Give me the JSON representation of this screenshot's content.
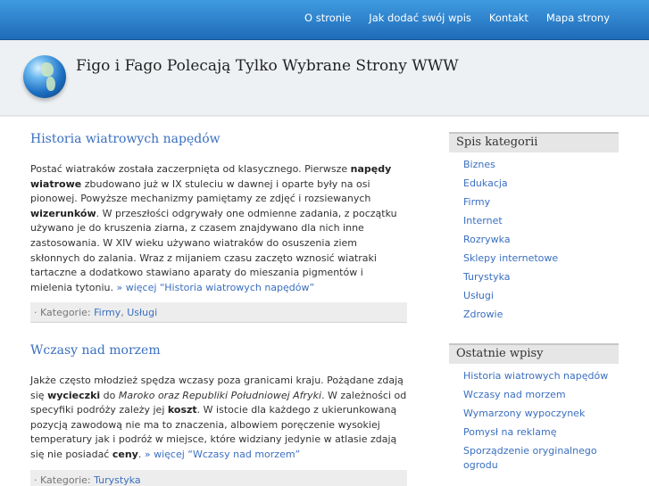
{
  "nav": {
    "items": [
      "O stronie",
      "Jak dodać swój wpis",
      "Kontakt",
      "Mapa strony"
    ]
  },
  "site": {
    "title": "Figo i Fago Polecają Tylko Wybrane Strony WWW"
  },
  "posts": [
    {
      "title": "Historia wiatrowych napędów",
      "body": [
        {
          "t": "Postać wiatraków została zaczerpnięta od klasycznego. Pierwsze "
        },
        {
          "b": "napędy wiatrowe"
        },
        {
          "t": " zbudowano już w IX stuleciu w dawnej i oparte były na osi pionowej. Powyższe mechanizmy pamiętamy ze zdjęć i rozsiewanych "
        },
        {
          "b": "wizerunków"
        },
        {
          "t": ". W przeszłości odgrywały one odmienne zadania, z początku używano je do kruszenia ziarna, z czasem znajdywano dla nich inne zastosowania. W XIV wieku używano wiatraków do osuszenia ziem skłonnych do zalania. Wraz z mijaniem czasu zaczęto wznosić wiatraki tartaczne a dodatkowo stawiano aparaty do mieszania pigmentów i mielenia tytoniu. "
        },
        {
          "a": "» więcej “Historia wiatrowych napędów”"
        }
      ],
      "categories_label": "· Kategorie:",
      "categories": [
        "Firmy",
        "Usługi"
      ]
    },
    {
      "title": "Wczasy nad morzem",
      "body": [
        {
          "t": "Jakże często młodzież spędza wczasy poza granicami kraju. Pożądane zdają się "
        },
        {
          "b": "wycieczki"
        },
        {
          "t": " do "
        },
        {
          "i": "Maroko oraz Republiki Południowej Afryki"
        },
        {
          "t": ". W zależności od specyfiki podróży zależy jej "
        },
        {
          "b": "koszt"
        },
        {
          "t": ". W istocie dla każdego z ukierunkowaną pozycją zawodową nie ma to znaczenia, albowiem poręczenie wysokiej temperatury jak i podróż w miejsce, które widziany jedynie w atlasie zdają się nie posiadać "
        },
        {
          "b": "ceny"
        },
        {
          "t": ". "
        },
        {
          "a": "» więcej “Wczasy nad morzem”"
        }
      ],
      "categories_label": "· Kategorie:",
      "categories": [
        "Turystyka"
      ]
    }
  ],
  "sidebar": {
    "categories_title": "Spis kategorii",
    "categories": [
      "Biznes",
      "Edukacja",
      "Firmy",
      "Internet",
      "Rozrywka",
      "Sklepy internetowe",
      "Turystyka",
      "Usługi",
      "Zdrowie"
    ],
    "recent_title": "Ostatnie wpisy",
    "recent": [
      "Historia wiatrowych napędów",
      "Wczasy nad morzem",
      "Wymarzony wypoczynek",
      "Pomysł na reklamę",
      "Sporządzenie oryginalnego ogrodu"
    ]
  }
}
